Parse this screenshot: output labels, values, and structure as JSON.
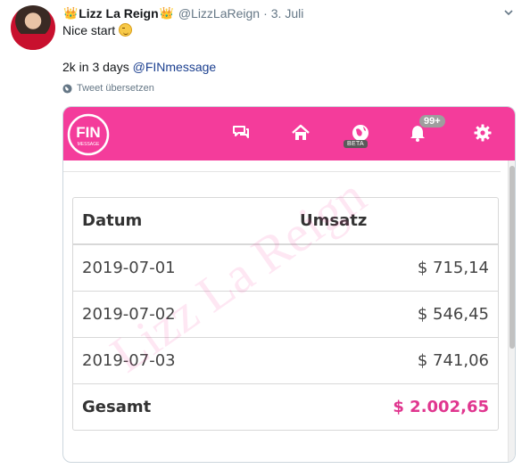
{
  "tweet": {
    "display_name": "Lizz La Reign",
    "handle": "@LizzLaReign",
    "separator": "·",
    "date": "3. Juli",
    "line1": "Nice start",
    "line2_text": "2k in 3 days ",
    "line2_mention": "@FINmessage",
    "translate_label": "Tweet übersetzen",
    "crown_glyph": "👑"
  },
  "app": {
    "logo_text": "FIN",
    "logo_subtext": "MESSAGE",
    "beta_label": "BETA",
    "notification_badge": "99+",
    "brand_color": "#f43c9b",
    "icons": [
      "chat-icon",
      "home-icon",
      "globe-icon",
      "bell-icon",
      "gear-icon"
    ]
  },
  "table": {
    "headers": [
      "Datum",
      "Umsatz"
    ],
    "rows": [
      {
        "date": "2019-07-01",
        "amount": "$ 715,14"
      },
      {
        "date": "2019-07-02",
        "amount": "$ 546,45"
      },
      {
        "date": "2019-07-03",
        "amount": "$ 741,06"
      }
    ],
    "total_label": "Gesamt",
    "total_value": "$ 2.002,65"
  },
  "watermark": "Lizz La Reign"
}
